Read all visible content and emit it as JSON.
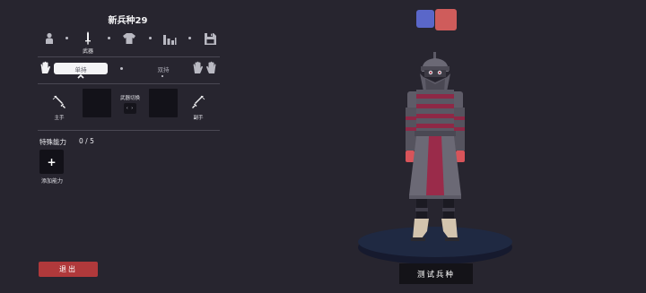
{
  "header": {
    "title": "新兵种29"
  },
  "tabs": [
    {
      "name": "unit-tab",
      "icon": "unit-icon",
      "label": ""
    },
    {
      "name": "weapon-tab",
      "icon": "sword-icon",
      "label": "武器"
    },
    {
      "name": "armor-tab",
      "icon": "shirt-icon",
      "label": ""
    },
    {
      "name": "stats-tab",
      "icon": "bar-chart-icon",
      "label": ""
    },
    {
      "name": "save-tab",
      "icon": "save-icon",
      "label": ""
    }
  ],
  "hand_mode": {
    "one_hand": "单持",
    "two_hand": "双持",
    "selected": "one_hand"
  },
  "weapons": {
    "swap_label": "武器切换",
    "swap_button": "‹ ›",
    "main_hand_label": "主手",
    "off_hand_label": "副手"
  },
  "special": {
    "label": "特殊能力",
    "count": "0 / 5",
    "add_label": "添加能力",
    "add_button": "+"
  },
  "footer": {
    "exit_label": "退出",
    "test_label": "测试兵种"
  },
  "colors": {
    "background": "#27252f",
    "team_blue": "#5a67c9",
    "team_red": "#cf5c5b",
    "exit_button": "#b0393b",
    "unit_armor_red": "#9a2b4a"
  }
}
